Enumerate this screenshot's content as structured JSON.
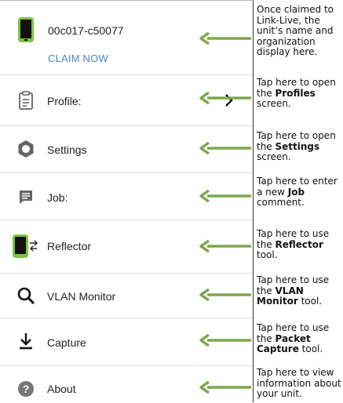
{
  "header": {
    "unit_name": "00c017-c50077",
    "claim_label": "CLAIM NOW",
    "note": "Once claimed to Link-Live, the unit’s name and organization display here."
  },
  "menu": [
    {
      "label": "Profile:",
      "icon": "clipboard-icon",
      "note_pre": "Tap here to open the ",
      "note_bold": "Profiles",
      "note_post": " screen."
    },
    {
      "label": "Settings",
      "icon": "gear-icon",
      "note_pre": "Tap here to open the ",
      "note_bold": "Settings",
      "note_post": " screen."
    },
    {
      "label": "Job:",
      "icon": "comment-icon",
      "note_pre": "Tap here to enter a new ",
      "note_bold": "Job",
      "note_post": " comment."
    },
    {
      "label": "Reflector",
      "icon": "reflector-icon",
      "note_pre": "Tap here to use the ",
      "note_bold": "Reflector",
      "note_post": " tool."
    },
    {
      "label": "VLAN Monitor",
      "icon": "magnifier-icon",
      "note_pre": "Tap here to use the ",
      "note_bold": "VLAN Monitor",
      "note_post": " tool."
    },
    {
      "label": "Capture",
      "icon": "download-icon",
      "note_pre": "Tap here to use the ",
      "note_bold": "Packet Capture",
      "note_post": " tool."
    },
    {
      "label": "About",
      "icon": "help-icon",
      "note_pre": "Tap here to view information about your unit.",
      "note_bold": "",
      "note_post": ""
    }
  ],
  "colors": {
    "arrow": "#7aa84d",
    "link": "#4a84c4",
    "device_accent": "#7dc242"
  }
}
